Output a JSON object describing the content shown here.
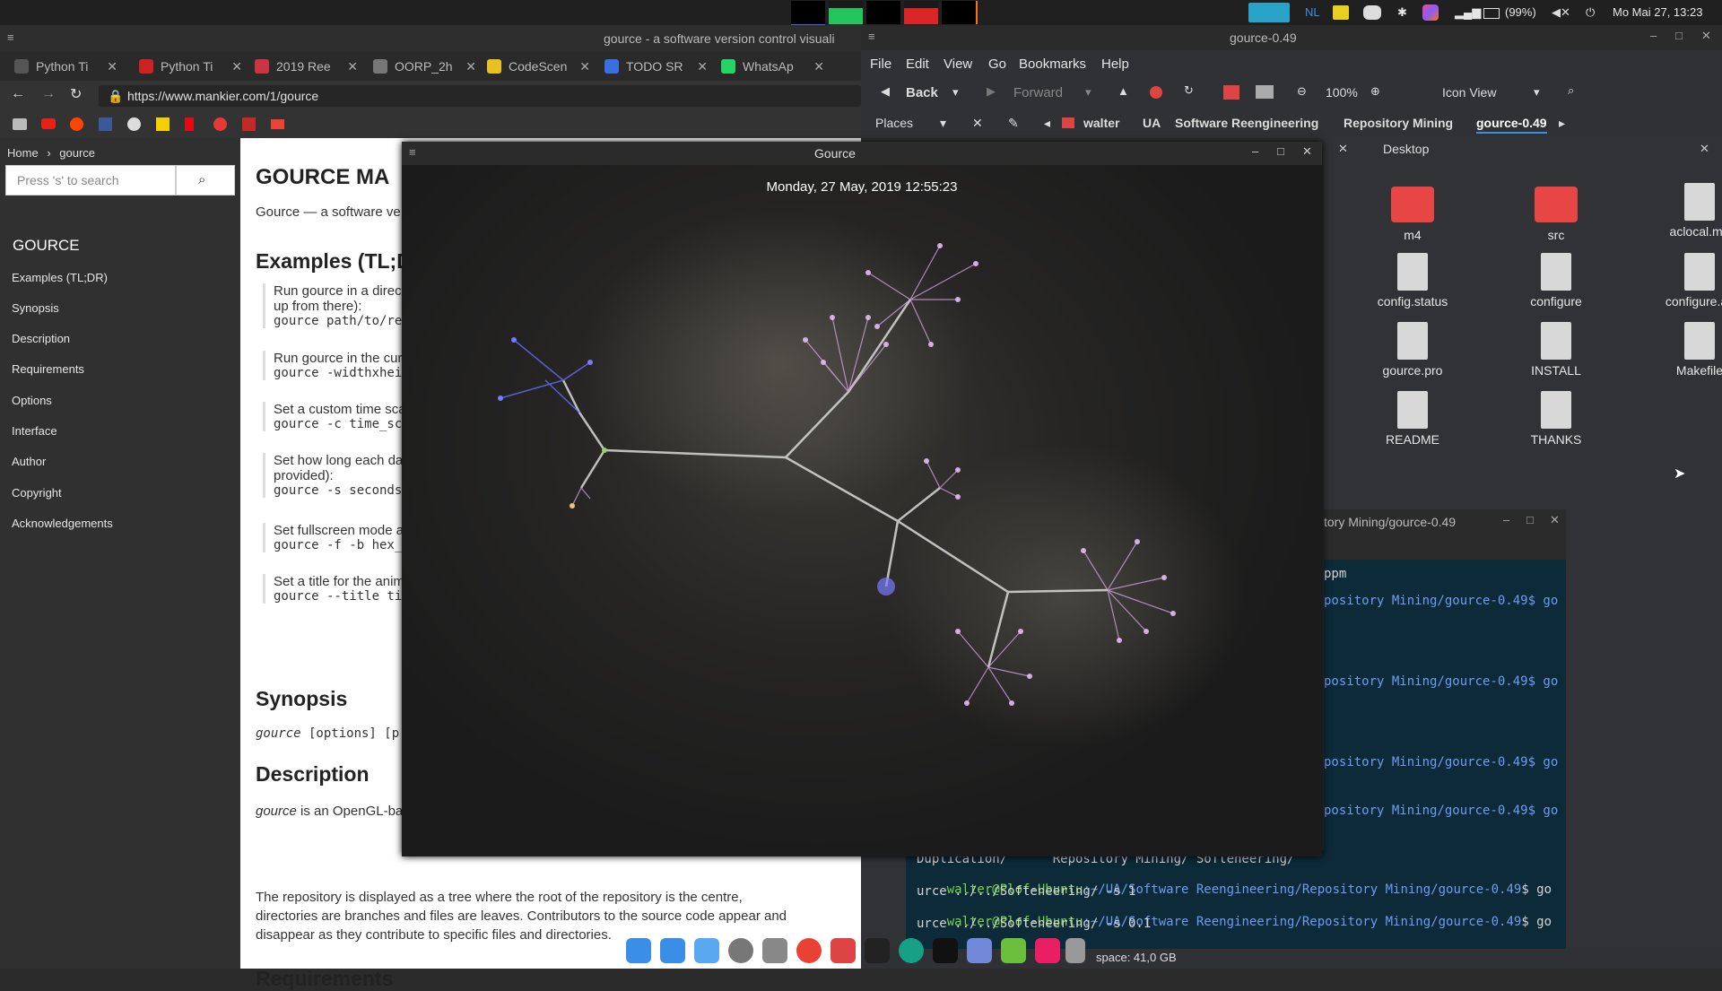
{
  "top_panel": {
    "keyboard": "NL",
    "battery": "(99%)",
    "clock": "Mo Mai 27, 13:23"
  },
  "browser": {
    "window_title": "gource - a software version control visuali",
    "tabs": [
      {
        "label": "Python Ti",
        "color": "#555555"
      },
      {
        "label": "Python Ti",
        "color": "#cc2222"
      },
      {
        "label": "2019 Ree",
        "color": "#cc3344"
      },
      {
        "label": "OORP_2h",
        "color": "#777777"
      },
      {
        "label": "CodeScen",
        "color": "#e8c020"
      },
      {
        "label": "TODO SR",
        "color": "#3a6fe0"
      },
      {
        "label": "WhatsAp",
        "color": "#25d366"
      }
    ],
    "url": "https://www.mankier.com/1/gource",
    "breadcrumb": {
      "home": "Home",
      "sep": "›",
      "current": "gource"
    },
    "search_placeholder": "Press 's' to search",
    "sidebar": {
      "title": "GOURCE",
      "links": [
        "Examples (TL;DR)",
        "Synopsis",
        "Description",
        "Requirements",
        "Options",
        "Interface",
        "Author",
        "Copyright",
        "Acknowledgements"
      ]
    },
    "content": {
      "heading": "GOURCE MA",
      "tagline": "Gource — a software ve",
      "examples_heading": "Examples (TL;D",
      "examples": [
        {
          "text": "Run gource in a direct",
          "text2": "up from there):",
          "code": "gource path/to/rep"
        },
        {
          "text": "Run gource in the curr",
          "text2": "",
          "code": "gource -widthxheig"
        },
        {
          "text": "Set a custom time sca",
          "text2": "",
          "code": "gource -c time_sca"
        },
        {
          "text": "Set how long each da",
          "text2": "provided):",
          "code": "gource -s seconds"
        },
        {
          "text": "Set fullscreen mode a",
          "text2": "",
          "code": "gource -f -b hex_c"
        },
        {
          "text": "Set a title for the anim",
          "text2": "",
          "code": "gource --title tit"
        }
      ],
      "synopsis_heading": "Synopsis",
      "synopsis_cmd": "gource",
      "synopsis_rest": " [options] [p",
      "description_heading": "Description",
      "description_em": "gource",
      "description_rest": " is an OpenGL-ba",
      "paragraph": "The repository is displayed as a tree where the root of the repository is the centre, directories are branches and files are leaves. Contributors to the source code appear and disappear as they contribute to specific files and directories.",
      "requirements_heading": "Requirements"
    }
  },
  "file_manager": {
    "window_title": "gource-0.49",
    "menu": [
      "File",
      "Edit",
      "View",
      "Go",
      "Bookmarks",
      "Help"
    ],
    "toolbar": {
      "back": "Back",
      "forward": "Forward",
      "zoom": "100%",
      "view_mode": "Icon View"
    },
    "places": "Places",
    "path": [
      "walter",
      "UA",
      "Software Reengineering",
      "Repository Mining",
      "gource-0.49"
    ],
    "panel_label": "Desktop",
    "files": [
      {
        "name": "m4",
        "type": "folder"
      },
      {
        "name": "src",
        "type": "folder"
      },
      {
        "name": "aclocal.m4",
        "type": "doc"
      },
      {
        "name": "config.status",
        "type": "script"
      },
      {
        "name": "configure",
        "type": "script"
      },
      {
        "name": "configure.ac",
        "type": "doc"
      },
      {
        "name": "gource.pro",
        "type": "doc"
      },
      {
        "name": "INSTALL",
        "type": "doc"
      },
      {
        "name": "Makefile",
        "type": "doc"
      },
      {
        "name": "README",
        "type": "doc"
      },
      {
        "name": "THANKS",
        "type": "doc"
      }
    ],
    "free_space": "space: 41,0 GB"
  },
  "terminal": {
    "window_title": "tory Mining/gource-0.49",
    "lines_right": [
      {
        "text": "ppm"
      },
      {
        "text": "pository Mining/gource-0.49$ go"
      },
      {
        "text": "pository Mining/gource-0.49$ go"
      },
      {
        "text": "pository Mining/gource-0.49$ go"
      },
      {
        "text": "pository Mining/gource-0.49$ go"
      }
    ],
    "bottom_lines": [
      {
        "text": "Duplication/      Repository Mining/ Softeneering/"
      },
      {
        "user": "walter@Plof-Ubuntu",
        "path": ":~/UA/Software Reengineering/Repository Mining/gource-0.49",
        "cmd": "$ go"
      },
      {
        "text": "urce ../../Softeneering/ -s 1"
      },
      {
        "user": "walter@Plof-Ubuntu",
        "path": ":~/UA/Software Reengineering/Repository Mining/gource-0.49",
        "cmd": "$ go"
      },
      {
        "text": "urce ../../Softeneering/ -s 0.1"
      }
    ]
  },
  "gource": {
    "window_title": "Gource",
    "date": "Monday, 27 May, 2019 12:55:23"
  }
}
